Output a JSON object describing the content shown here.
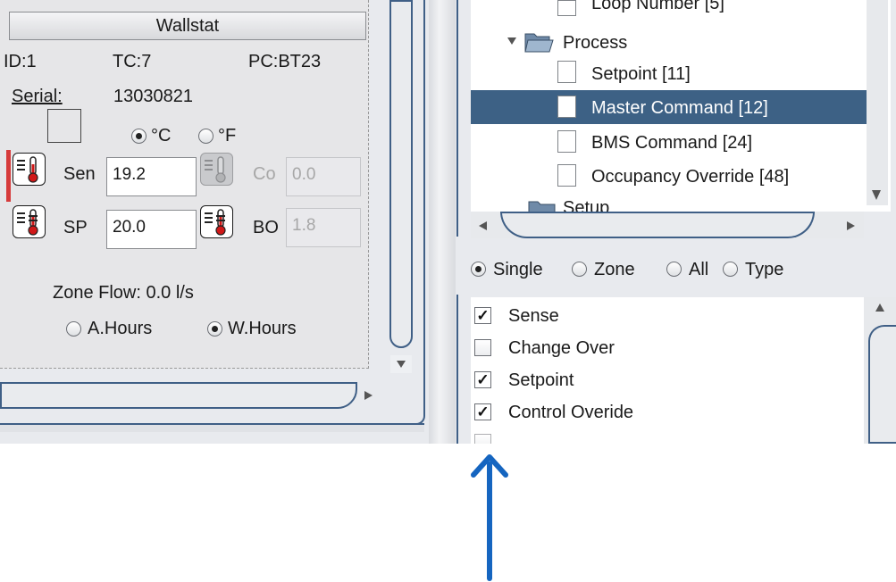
{
  "wallstat": {
    "title": "Wallstat",
    "id_label": "ID:1",
    "tc_label": "TC:7",
    "pc_label": "PC:BT23",
    "serial_label": "Serial:",
    "serial_value": "13030821",
    "unit_c": "°C",
    "unit_f": "°F",
    "unit_selected": "°C",
    "sense_label": "Sen",
    "sense_value": "19.2",
    "changeover_label": "Co",
    "changeover_value": "0.0",
    "setpoint_label": "SP",
    "setpoint_value": "20.0",
    "bo_label": "BO",
    "bo_value": "1.8",
    "zone_flow": "Zone Flow: 0.0 l/s",
    "hours_a": "A.Hours",
    "hours_w": "W.Hours",
    "hours_selected": "W.Hours"
  },
  "tree": {
    "top_partial": "Loop Number [5]",
    "folder_label": "Process",
    "items": [
      {
        "label": "Setpoint [11]",
        "selected": false
      },
      {
        "label": "Master Command [12]",
        "selected": true
      },
      {
        "label": "BMS Command [24]",
        "selected": false
      },
      {
        "label": "Occupancy Override [48]",
        "selected": false
      }
    ],
    "bottom_partial": "Setup"
  },
  "scope": {
    "options": [
      "Single",
      "Zone",
      "All",
      "Type"
    ],
    "selected": "Single"
  },
  "checks": [
    {
      "label": "Sense",
      "checked": true
    },
    {
      "label": "Change Over",
      "checked": false
    },
    {
      "label": "Setpoint",
      "checked": true
    },
    {
      "label": "Control Overide",
      "checked": true
    }
  ],
  "colors": {
    "selection": "#3d6185",
    "annotation_arrow": "#1565c0",
    "frame": "#3f5f86"
  }
}
